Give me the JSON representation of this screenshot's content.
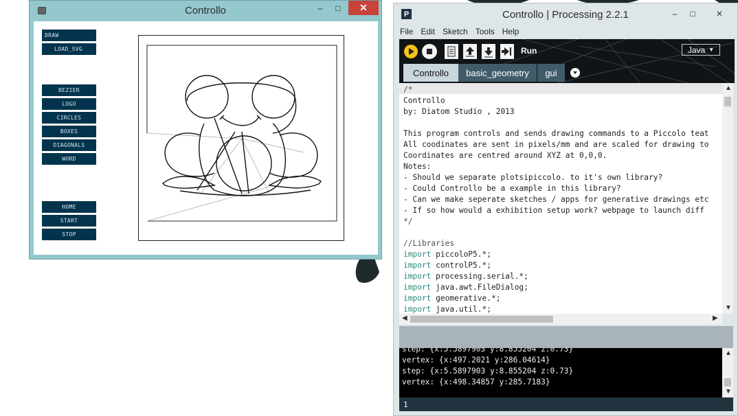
{
  "left_window": {
    "title": "Controllo",
    "controls": {
      "minimize": "–",
      "maximize": "□",
      "close": "✕"
    },
    "buttons": [
      "DRAW",
      "LOAD_SVG",
      "BEZIER",
      "LOGO",
      "CIRCLES",
      "BOXES",
      "DIAGONALS",
      "WORD",
      "HOME",
      "START",
      "STOP"
    ]
  },
  "right_window": {
    "title": "Controllo | Processing 2.2.1",
    "controls": {
      "minimize": "–",
      "maximize": "□",
      "close": "✕"
    },
    "menu": [
      "File",
      "Edit",
      "Sketch",
      "Tools",
      "Help"
    ],
    "toolbar": {
      "run_label": "Run",
      "mode": "Java"
    },
    "tabs": [
      "Controllo",
      "basic_geometry",
      "gui"
    ],
    "code_lines": [
      "/*",
      "Controllo",
      "by: Diatom Studio , 2013",
      "",
      "This program controls and sends drawing commands to a Piccolo teat",
      "All coodinates are sent in pixels/mm and are scaled for drawing to",
      "Coordinates are centred around XYZ at 0,0,0.",
      "Notes:",
      "- Should we separate plotsipiccolo. to it's own library?",
      "- Could Controllo be a example in this library?",
      "- Can we make seperate sketches / apps for generative drawings etc",
      "- If so how would a exhibition setup work? webpage to launch diff",
      "*/",
      "",
      "//Libraries"
    ],
    "import_keyword": "import",
    "imports": [
      "piccoloP5.*;",
      "controlP5.*;",
      "processing.serial.*;",
      "java.awt.FileDialog;",
      "geomerative.*;",
      "java.util.*;"
    ],
    "console_lines": [
      "step: {x:5.5897903 y:8.855204 z:0.73}",
      "vertex: {x:497.2021 y:286.04614}",
      "step: {x:5.5897903 y:8.855204 z:0.73}",
      "vertex: {x:498.34857 y:285.7183}"
    ],
    "line_number": "1"
  }
}
